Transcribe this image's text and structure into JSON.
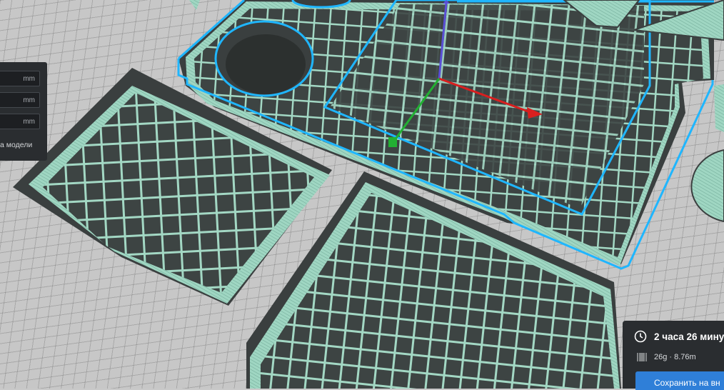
{
  "scale_panel": {
    "fields": [
      {
        "value": "",
        "unit": "mm"
      },
      {
        "value": "",
        "unit": "mm"
      },
      {
        "value": "",
        "unit": "mm"
      }
    ],
    "uniform_label": "а модели"
  },
  "print_info": {
    "time": "2 часа 26 мину",
    "material": "26g · 8.76m",
    "save_label": "Сохранить на вн"
  },
  "colors": {
    "infill": "#9fd6c2",
    "wall": "#3c4140",
    "selection": "#1fb6ff",
    "axis_x": "#d81f1f",
    "axis_y": "#22b033",
    "axis_z": "#5a4fd6",
    "panel": "#2a2d30",
    "accent": "#2f7fd8"
  }
}
